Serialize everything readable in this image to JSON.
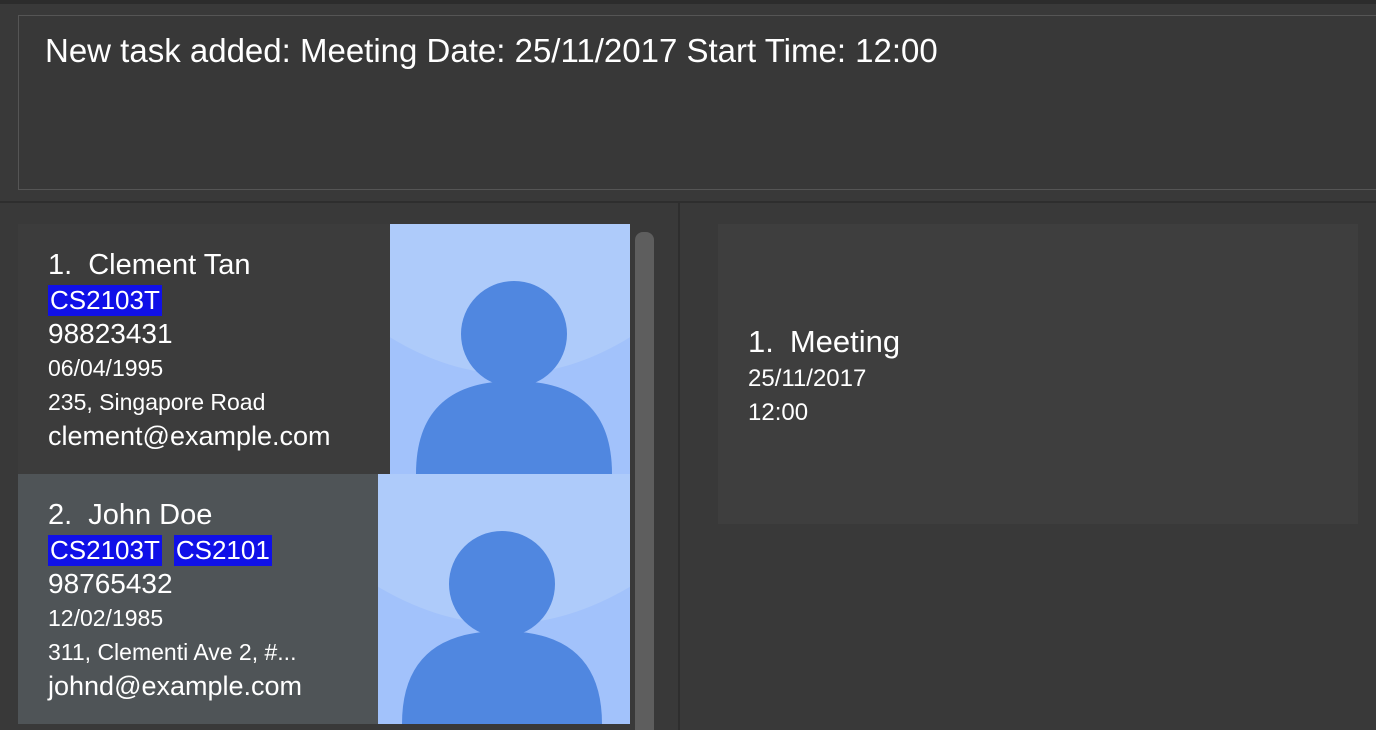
{
  "result_display": {
    "message": "New task added: Meeting Date: 25/11/2017 Start Time: 12:00"
  },
  "persons": [
    {
      "index": "1.",
      "name": "Clement Tan",
      "tags": [
        "CS2103T"
      ],
      "phone": "98823431",
      "birthday": "06/04/1995",
      "address": "235, Singapore Road",
      "email": "clement@example.com"
    },
    {
      "index": "2.",
      "name": "John Doe",
      "tags": [
        "CS2103T",
        "CS2101"
      ],
      "phone": "98765432",
      "birthday": "12/02/1985",
      "address": "311, Clementi Ave 2, #...",
      "email": "johnd@example.com"
    }
  ],
  "tasks": [
    {
      "index": "1.",
      "name": "Meeting",
      "date": "25/11/2017",
      "time": "12:00"
    }
  ],
  "colors": {
    "background": "#393939",
    "tag": "#1010e8",
    "selected_card": "#4f5457",
    "avatar_bg": "#aecbfa",
    "avatar_figure": "#5087e0"
  }
}
